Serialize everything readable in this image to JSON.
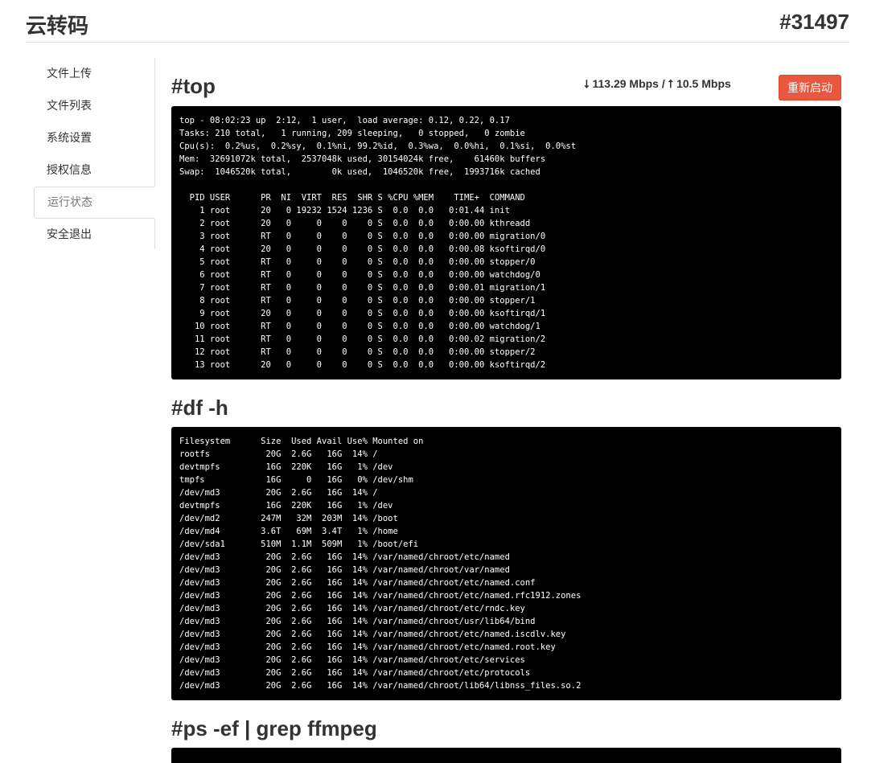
{
  "header": {
    "brand": "云转码",
    "server_id": "#31497"
  },
  "sidebar": {
    "items": [
      {
        "label": "文件上传"
      },
      {
        "label": "文件列表"
      },
      {
        "label": "系统设置"
      },
      {
        "label": "授权信息"
      },
      {
        "label": "运行状态",
        "active": true
      },
      {
        "label": "安全退出"
      }
    ]
  },
  "top_section": {
    "title": "#top",
    "network": "⭣ 113.29 Mbps / ⭡ 10.5 Mbps",
    "restart_label": "重新启动",
    "output": "top - 08:02:23 up  2:12,  1 user,  load average: 0.12, 0.22, 0.17\nTasks: 210 total,   1 running, 209 sleeping,   0 stopped,   0 zombie\nCpu(s):  0.2%us,  0.2%sy,  0.1%ni, 99.2%id,  0.3%wa,  0.0%hi,  0.1%si,  0.0%st\nMem:  32691072k total,  2537048k used, 30154024k free,    61460k buffers\nSwap:  1046520k total,        0k used,  1046520k free,  1993716k cached\n\n  PID USER      PR  NI  VIRT  RES  SHR S %CPU %MEM    TIME+  COMMAND\n    1 root      20   0 19232 1524 1236 S  0.0  0.0   0:01.44 init\n    2 root      20   0     0    0    0 S  0.0  0.0   0:00.00 kthreadd\n    3 root      RT   0     0    0    0 S  0.0  0.0   0:00.00 migration/0\n    4 root      20   0     0    0    0 S  0.0  0.0   0:00.08 ksoftirqd/0\n    5 root      RT   0     0    0    0 S  0.0  0.0   0:00.00 stopper/0\n    6 root      RT   0     0    0    0 S  0.0  0.0   0:00.00 watchdog/0\n    7 root      RT   0     0    0    0 S  0.0  0.0   0:00.01 migration/1\n    8 root      RT   0     0    0    0 S  0.0  0.0   0:00.00 stopper/1\n    9 root      20   0     0    0    0 S  0.0  0.0   0:00.00 ksoftirqd/1\n   10 root      RT   0     0    0    0 S  0.0  0.0   0:00.00 watchdog/1\n   11 root      RT   0     0    0    0 S  0.0  0.0   0:00.02 migration/2\n   12 root      RT   0     0    0    0 S  0.0  0.0   0:00.00 stopper/2\n   13 root      20   0     0    0    0 S  0.0  0.0   0:00.00 ksoftirqd/2"
  },
  "df_section": {
    "title": "#df -h",
    "output": "Filesystem      Size  Used Avail Use% Mounted on\nrootfs           20G  2.6G   16G  14% /\ndevtmpfs         16G  220K   16G   1% /dev\ntmpfs            16G     0   16G   0% /dev/shm\n/dev/md3         20G  2.6G   16G  14% /\ndevtmpfs         16G  220K   16G   1% /dev\n/dev/md2        247M   32M  203M  14% /boot\n/dev/md4        3.6T   69M  3.4T   1% /home\n/dev/sda1       510M  1.1M  509M   1% /boot/efi\n/dev/md3         20G  2.6G   16G  14% /var/named/chroot/etc/named\n/dev/md3         20G  2.6G   16G  14% /var/named/chroot/var/named\n/dev/md3         20G  2.6G   16G  14% /var/named/chroot/etc/named.conf\n/dev/md3         20G  2.6G   16G  14% /var/named/chroot/etc/named.rfc1912.zones\n/dev/md3         20G  2.6G   16G  14% /var/named/chroot/etc/rndc.key\n/dev/md3         20G  2.6G   16G  14% /var/named/chroot/usr/lib64/bind\n/dev/md3         20G  2.6G   16G  14% /var/named/chroot/etc/named.iscdlv.key\n/dev/md3         20G  2.6G   16G  14% /var/named/chroot/etc/named.root.key\n/dev/md3         20G  2.6G   16G  14% /var/named/chroot/etc/services\n/dev/md3         20G  2.6G   16G  14% /var/named/chroot/etc/protocols\n/dev/md3         20G  2.6G   16G  14% /var/named/chroot/lib64/libnss_files.so.2"
  },
  "ps_section": {
    "title": "#ps -ef | grep ffmpeg",
    "output": ""
  },
  "colors": {
    "accent": "#e9573f",
    "terminal_bg": "#000000"
  }
}
